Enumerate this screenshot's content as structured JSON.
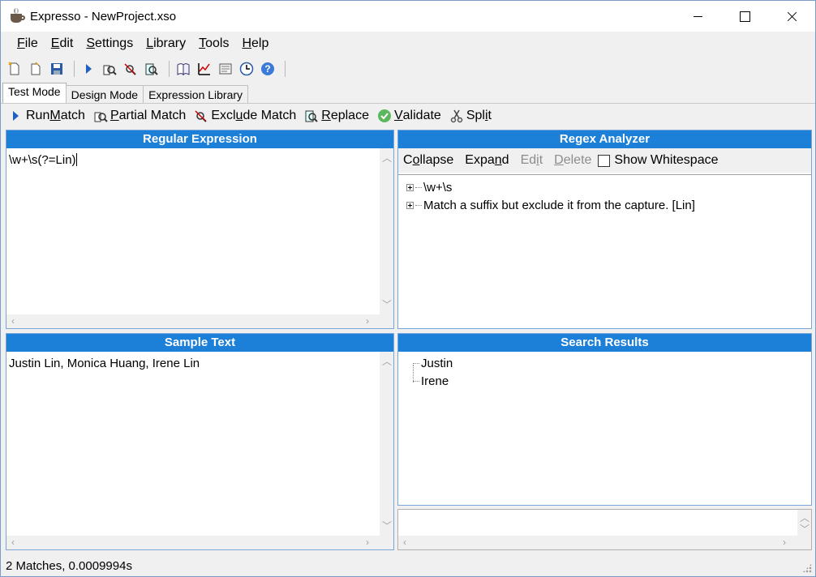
{
  "window": {
    "title": "Expresso - NewProject.xso"
  },
  "menu": [
    {
      "label": "File",
      "accel": "F",
      "rest": "ile"
    },
    {
      "label": "Edit",
      "accel": "E",
      "rest": "dit"
    },
    {
      "label": "Settings",
      "accel": "S",
      "rest": "ettings"
    },
    {
      "label": "Library",
      "accel": "L",
      "rest": "ibrary"
    },
    {
      "label": "Tools",
      "accel": "T",
      "rest": "ools"
    },
    {
      "label": "Help",
      "accel": "H",
      "rest": "elp"
    }
  ],
  "tabs": [
    {
      "label": "Test Mode",
      "active": true
    },
    {
      "label": "Design Mode",
      "active": false
    },
    {
      "label": "Expression Library",
      "active": false
    }
  ],
  "actions": {
    "run_pre": "Run ",
    "run_accel": "M",
    "run_post": "atch",
    "partial_pre": "",
    "partial_accel": "P",
    "partial_post": "artial Match",
    "exclude_pre": "Excl",
    "exclude_accel": "u",
    "exclude_post": "de Match",
    "replace_pre": "",
    "replace_accel": "R",
    "replace_post": "eplace",
    "validate_pre": "",
    "validate_accel": "V",
    "validate_post": "alidate",
    "split_pre": "Spl",
    "split_accel": "i",
    "split_post": "t"
  },
  "regex_panel": {
    "title": "Regular Expression",
    "value": "\\w+\\s(?=Lin)"
  },
  "analyzer": {
    "title": "Regex Analyzer",
    "collapse_pre": "C",
    "collapse_accel": "o",
    "collapse_post": "llapse",
    "expand_pre": "Expa",
    "expand_accel": "n",
    "expand_post": "d",
    "edit_pre": "Ed",
    "edit_accel": "i",
    "edit_post": "t",
    "delete_pre": "",
    "delete_accel": "D",
    "delete_post": "elete",
    "show_whitespace": "Show Whitespace",
    "nodes": [
      "\\w+\\s",
      "Match a suffix but exclude it from the capture. [Lin]"
    ]
  },
  "sample": {
    "title": "Sample Text",
    "value": "Justin Lin, Monica Huang, Irene Lin"
  },
  "results": {
    "title": "Search Results",
    "items": [
      "Justin",
      "Irene"
    ]
  },
  "status": {
    "text": "2 Matches, 0.0009994s"
  }
}
